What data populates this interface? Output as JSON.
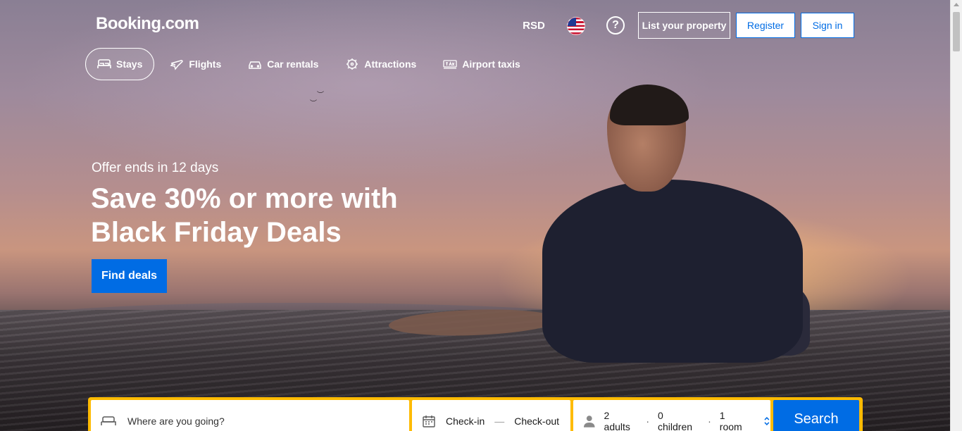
{
  "header": {
    "logo": "Booking.com",
    "currency": "RSD",
    "language_icon": "us-flag-icon",
    "help_icon": "question-circle-icon",
    "list_property_label": "List your property",
    "register_label": "Register",
    "signin_label": "Sign in"
  },
  "nav": {
    "tabs": [
      {
        "label": "Stays",
        "icon": "bed-icon",
        "active": true
      },
      {
        "label": "Flights",
        "icon": "plane-icon",
        "active": false
      },
      {
        "label": "Car rentals",
        "icon": "car-icon",
        "active": false
      },
      {
        "label": "Attractions",
        "icon": "attractions-icon",
        "active": false
      },
      {
        "label": "Airport taxis",
        "icon": "taxi-icon",
        "active": false
      }
    ]
  },
  "hero": {
    "offer_text": "Offer ends in 12 days",
    "headline": "Save 30% or more with Black Friday Deals",
    "cta_label": "Find deals"
  },
  "search": {
    "destination_placeholder": "Where are you going?",
    "checkin_label": "Check-in",
    "date_separator": "—",
    "checkout_label": "Check-out",
    "adults": "2 adults",
    "children": "0 children",
    "rooms": "1 room",
    "separator": "·",
    "search_label": "Search"
  },
  "colors": {
    "brand_blue": "#006ce4",
    "search_border": "#febb02"
  }
}
